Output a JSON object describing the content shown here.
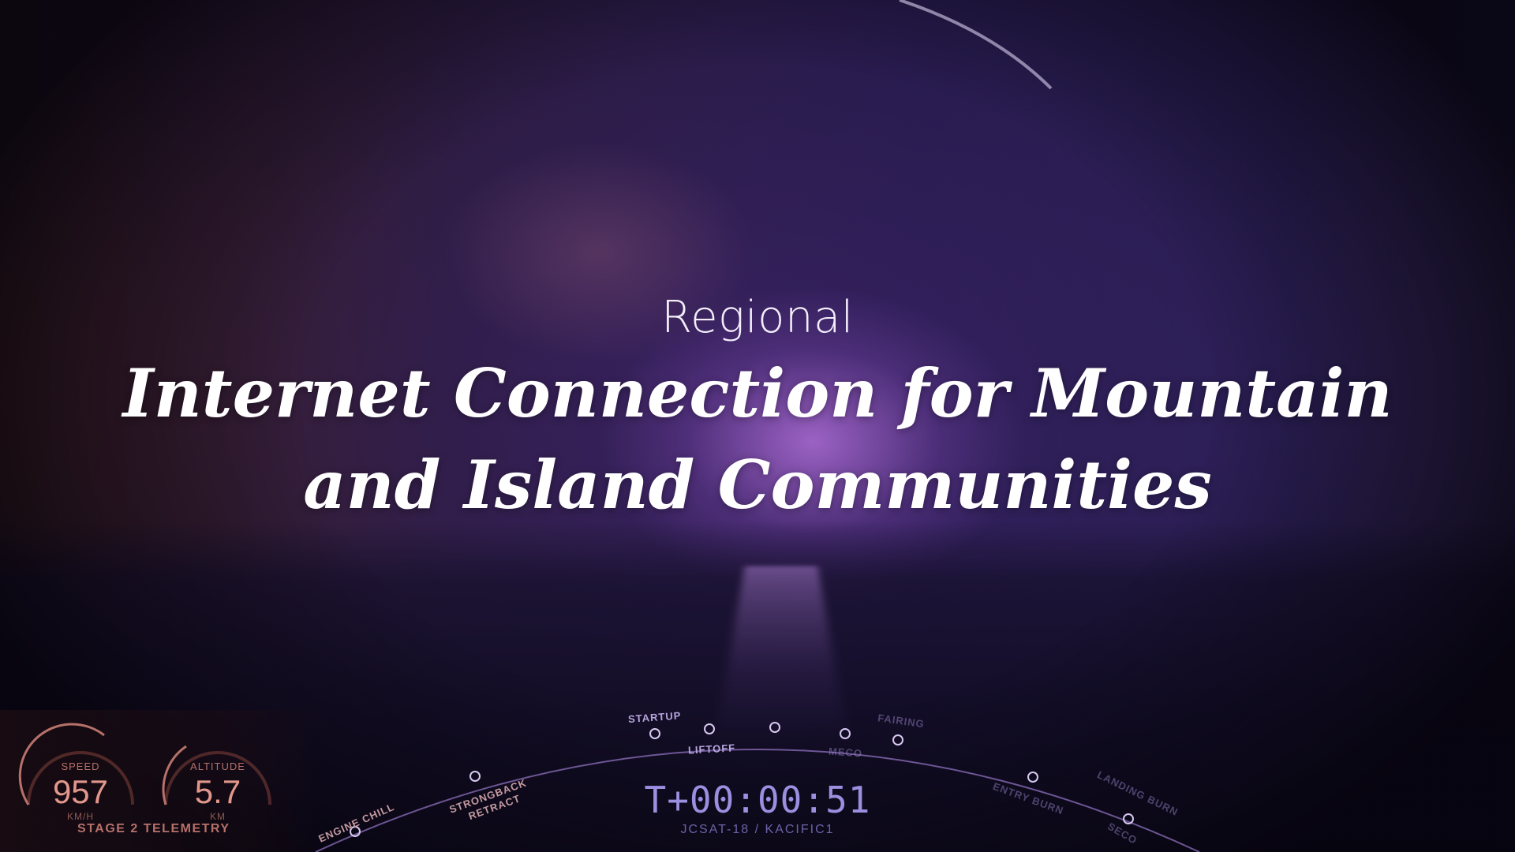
{
  "title": {
    "kicker": "Regional",
    "headline_line1": "Internet Connection for Mountain",
    "headline_line2": "and Island Communities"
  },
  "telemetry": {
    "panel_title": "STAGE 2 TELEMETRY",
    "speed": {
      "label": "SPEED",
      "value": "957",
      "unit": "KM/H"
    },
    "altitude": {
      "label": "ALTITUDE",
      "value": "5.7",
      "unit": "KM"
    }
  },
  "timeline": {
    "clock": "T+00:00:51",
    "mission": "JCSAT-18 / KACIFIC1",
    "events": [
      "ENGINE CHILL",
      "STRONGBACK",
      "RETRACT",
      "STARTUP",
      "LIFTOFF",
      "MECO",
      "FAIRING",
      "ENTRY BURN",
      "LANDING BURN",
      "SECO"
    ]
  },
  "colors": {
    "telemetry": "#b5716a",
    "timeline": "#9b8fe0",
    "title": "#ffffff"
  }
}
